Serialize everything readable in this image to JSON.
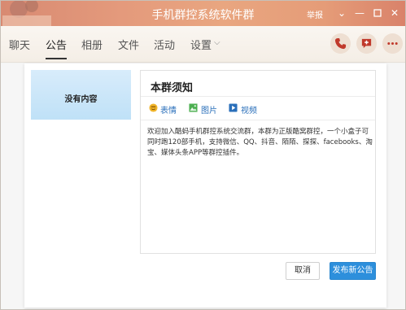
{
  "window": {
    "title": "手机群控系统软件群",
    "report_label": "举报",
    "minimize_icon": "minimize-icon",
    "maximize_icon": "maximize-icon",
    "close_icon": "close-icon"
  },
  "tabs": [
    {
      "label": "聊天",
      "active": false
    },
    {
      "label": "公告",
      "active": true
    },
    {
      "label": "相册",
      "active": false
    },
    {
      "label": "文件",
      "active": false
    },
    {
      "label": "活动",
      "active": false
    },
    {
      "label": "设置",
      "active": false
    }
  ],
  "actions": [
    "phone-icon",
    "add-chat-icon",
    "more-icon"
  ],
  "preview": {
    "empty_text": "没有内容"
  },
  "editor": {
    "title": "本群须知",
    "tools": [
      {
        "label": "表情",
        "icon": "emoji-icon",
        "color": "#f0b429"
      },
      {
        "label": "图片",
        "icon": "image-icon",
        "color": "#4caf50"
      },
      {
        "label": "视频",
        "icon": "video-icon",
        "color": "#2a6fba"
      }
    ],
    "body": "欢迎加入酷蚂手机群控系统交流群，本群为正版酷窝群控，一个小盒子可同时跑120部手机，支持微信、QQ、抖音、陌陌、探探、facebooks、淘宝、媒体头条APP等群控插件。"
  },
  "buttons": {
    "cancel": "取消",
    "publish": "发布新公告"
  },
  "colors": {
    "accent": "#2d8fdc",
    "titlebar": "#e49a7c"
  }
}
